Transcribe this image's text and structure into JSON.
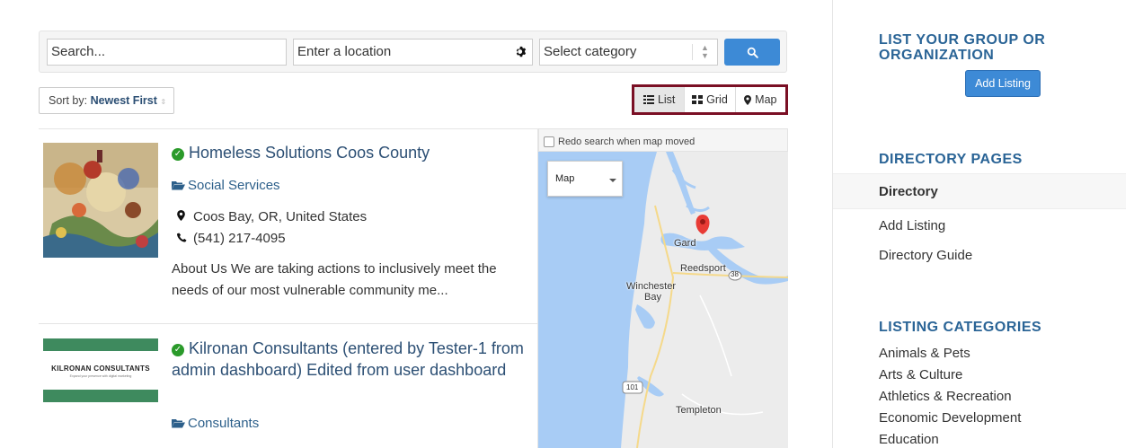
{
  "search": {
    "keyword_placeholder": "Search...",
    "location_placeholder": "Enter a location",
    "category_value": "Select category"
  },
  "sort": {
    "label": "Sort by:",
    "value": "Newest First"
  },
  "views": [
    {
      "label": "List",
      "icon": "list-icon",
      "active": true
    },
    {
      "label": "Grid",
      "icon": "grid-icon",
      "active": false
    },
    {
      "label": "Map",
      "icon": "map-marker-icon",
      "active": false
    }
  ],
  "listings": [
    {
      "title": "Homeless Solutions Coos County",
      "category": "Social Services",
      "location": "Coos Bay, OR, United States",
      "phone": "(541) 217-4095",
      "description": "About Us We are taking actions to inclusively meet the needs of our most vulnerable community me...",
      "verified": true
    },
    {
      "title": "Kilronan Consultants (entered by Tester-1 from admin dashboard) Edited from user dashboard",
      "category": "Consultants",
      "thumb_text": "KILRONAN CONSULTANTS",
      "thumb_subtext": "Expand your presence with digital marketing",
      "verified": true
    }
  ],
  "map": {
    "redo_label": "Redo search when map moved",
    "type_value": "Map",
    "labels": {
      "gardiner": "Gard",
      "reedsport": "Reedsport",
      "winchester": "Winchester",
      "winchester2": "Bay",
      "templeton": "Templeton",
      "hwy38": "38",
      "hwy101": "101"
    }
  },
  "sidebar": {
    "list_group_heading": "LIST YOUR GROUP OR ORGANIZATION",
    "add_listing_button": "Add Listing",
    "directory_heading": "DIRECTORY PAGES",
    "directory_items": [
      "Directory",
      "Add Listing",
      "Directory Guide"
    ],
    "categories_heading": "LISTING CATEGORIES",
    "categories": [
      "Animals & Pets",
      "Arts & Culture",
      "Athletics & Recreation",
      "Economic Development",
      "Education"
    ]
  },
  "colors": {
    "accent": "#3d8ad6",
    "link": "#2c4f74",
    "heading": "#2a6496",
    "highlight_border": "#7a0f24",
    "verified": "#2a9a2a"
  }
}
